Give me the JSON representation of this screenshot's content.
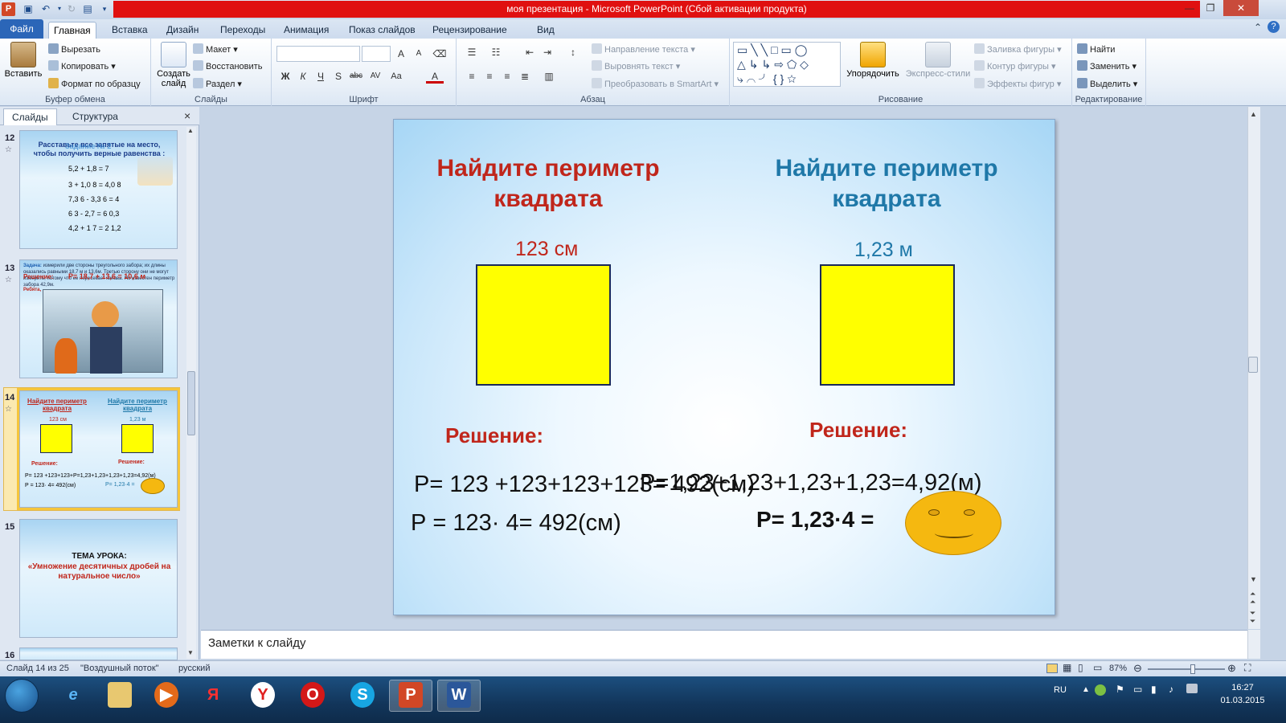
{
  "window": {
    "title": "моя презентация  -  Microsoft PowerPoint (Сбой активации продукта)"
  },
  "quick_access": [
    "save-icon",
    "undo-icon",
    "redo-icon",
    "screen-icon",
    "customize-icon"
  ],
  "menu": {
    "file": "Файл",
    "tabs": [
      "Главная",
      "Вставка",
      "Дизайн",
      "Переходы",
      "Анимация",
      "Показ слайдов",
      "Рецензирование",
      "Вид"
    ]
  },
  "ribbon": {
    "clipboard": {
      "paste": "Вставить",
      "cut": "Вырезать",
      "copy": "Копировать",
      "format_painter": "Формат по образцу",
      "label": "Буфер обмена"
    },
    "slides": {
      "new_slide": "Создать слайд",
      "layout": "Макет",
      "reset": "Восстановить",
      "section": "Раздел",
      "label": "Слайды"
    },
    "font": {
      "label": "Шрифт",
      "bold": "Ж",
      "italic": "К",
      "underline": "Ч",
      "shadow": "S",
      "strike": "abc",
      "spacing": "AV",
      "case": "Aa",
      "color": "A",
      "grow": "A",
      "shrink": "A"
    },
    "paragraph": {
      "text_direction": "Направление текста",
      "align_text": "Выровнять текст",
      "smartart": "Преобразовать в SmartArt",
      "label": "Абзац"
    },
    "drawing": {
      "arrange": "Упорядочить",
      "quick_styles": "Экспресс-стили",
      "fill": "Заливка фигуры",
      "outline": "Контур фигуры",
      "effects": "Эффекты фигур",
      "label": "Рисование"
    },
    "editing": {
      "find": "Найти",
      "replace": "Заменить",
      "select": "Выделить",
      "label": "Редактирование"
    }
  },
  "left_panel": {
    "tabs": [
      "Слайды",
      "Структура"
    ],
    "close": "×",
    "slides": [
      {
        "num": "12",
        "title": "Расставьте  все запятые на место, чтобы получить верные равенства :",
        "subtitle": "Задание  № 2",
        "lines": [
          "5,2 + 1,8 = 7",
          "3 + 1,0 8 = 4,0 8",
          "7,3 6 - 3,3 6 = 4",
          "6 3 - 2,7 = 6 0,3",
          "4,2 + 1 7 = 2 1,2"
        ]
      },
      {
        "num": "13",
        "task_label": "Задача:",
        "task": "измерили две стороны треугольного забора; их длины оказались равными 18,7 м и 13,6м. Третью сторону они не могут измерить, потому что ее пересекает канава. Но известен периметр забора 42,9м.",
        "overlay": "Решение:",
        "overlay2": "Р= 18,7 + 13,6 = 10,6 м",
        "sub": "Ребята,"
      },
      {
        "num": "14",
        "h1": "Найдите периметр квадрата",
        "h2": "Найдите периметр квадрата",
        "l1": "123 см",
        "l2": "1,23 м",
        "r1": "Решение:",
        "r2": "Решение:",
        "e1": "Р= 123 +123+123+Р=1,23+1,23+1,23+1,23=4,92(м)",
        "e2": "Р = 123· 4= 492(см)",
        "e3": "Р= 1,23·4 ="
      },
      {
        "num": "15",
        "title": "ТЕМА УРОКА:",
        "subtitle": "«Умножение десятичных дробей на натуральное число»"
      },
      {
        "num": "16"
      }
    ]
  },
  "slide": {
    "heading_left": "Найдите периметр квадрата",
    "heading_right": "Найдите периметр квадрата",
    "side_left": "123 см",
    "side_right": "1,23 м",
    "solution_left": "Решение:",
    "solution_right": "Решение:",
    "eq1_left": "Р= 123 +123+123+123= 492(см)",
    "eq1_right": "Р=1,23+1,23+1,23+1,23=4,92(м)",
    "eq2_left": "Р = 123· 4= 492(см)",
    "eq2_right": "Р= 1,23·4 ="
  },
  "notes": {
    "placeholder": "Заметки к слайду"
  },
  "status": {
    "slide_count": "Слайд 14 из 25",
    "theme": "\"Воздушный поток\"",
    "language": "русский",
    "zoom": "87%",
    "zoom_level": 0.87
  },
  "taskbar": {
    "lang": "RU",
    "time": "16:27",
    "date": "01.03.2015"
  }
}
